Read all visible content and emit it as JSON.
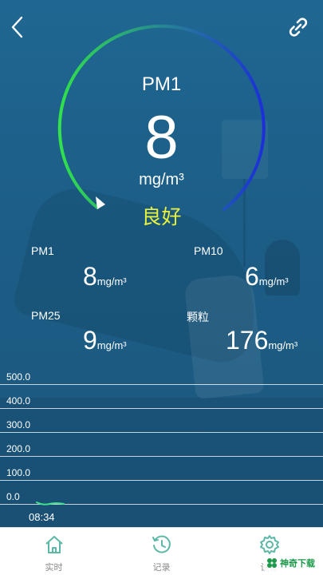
{
  "colors": {
    "gauge_arc_start": "#31e24a",
    "gauge_arc_end": "#1c2fd8",
    "status": "#e8f23a",
    "background": "#1d5c84",
    "nav_icon": "#5bb7a6"
  },
  "header": {
    "back_icon": "chevron-left-icon",
    "link_icon": "link-icon"
  },
  "gauge": {
    "pollutant": "PM1",
    "value": "8",
    "unit": "mg/m³",
    "status": "良好"
  },
  "readings": [
    {
      "label": "PM1",
      "value": "8",
      "unit": "mg/m³"
    },
    {
      "label": "PM10",
      "value": "6",
      "unit": "mg/m³"
    },
    {
      "label": "PM25",
      "value": "9",
      "unit": "mg/m³"
    },
    {
      "label": "颗粒",
      "value": "176",
      "unit": "mg/m³"
    }
  ],
  "history": {
    "y_ticks": [
      "500.0",
      "400.0",
      "300.0",
      "200.0",
      "100.0",
      "0.0"
    ],
    "time": "08:34"
  },
  "nav": [
    {
      "label": "实时",
      "icon": "home-icon"
    },
    {
      "label": "记录",
      "icon": "history-icon"
    },
    {
      "label": "设置",
      "icon": "gear-icon"
    }
  ],
  "watermark": {
    "text": "神奇下载",
    "icon": "clover-logo-icon"
  }
}
